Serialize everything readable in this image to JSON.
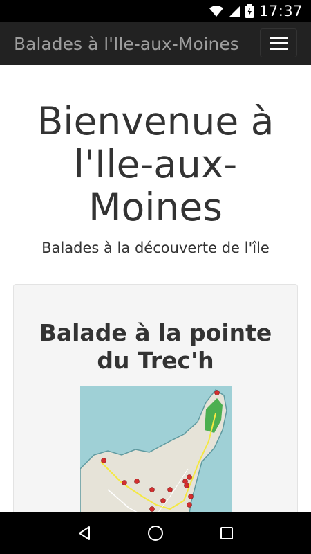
{
  "status_bar": {
    "time": "17:37"
  },
  "navbar": {
    "brand": "Balades à l'Ile-aux-Moines"
  },
  "hero": {
    "title_line1": "Bienvenue à",
    "title_line2": "l'Ile-aux-",
    "title_line3": "Moines",
    "subtitle": "Balades à la découverte de l'île"
  },
  "card": {
    "title_line1": "Balade à la pointe",
    "title_line2": "du Trec'h"
  },
  "colors": {
    "navbar_bg": "#222222",
    "brand_text": "#9d9d9d",
    "card_bg": "#f5f5f5",
    "sea": "#9fd0d6",
    "land": "#e8e6df",
    "park": "#4caf50",
    "marker": "#d32f2f",
    "route": "#f4e842"
  }
}
